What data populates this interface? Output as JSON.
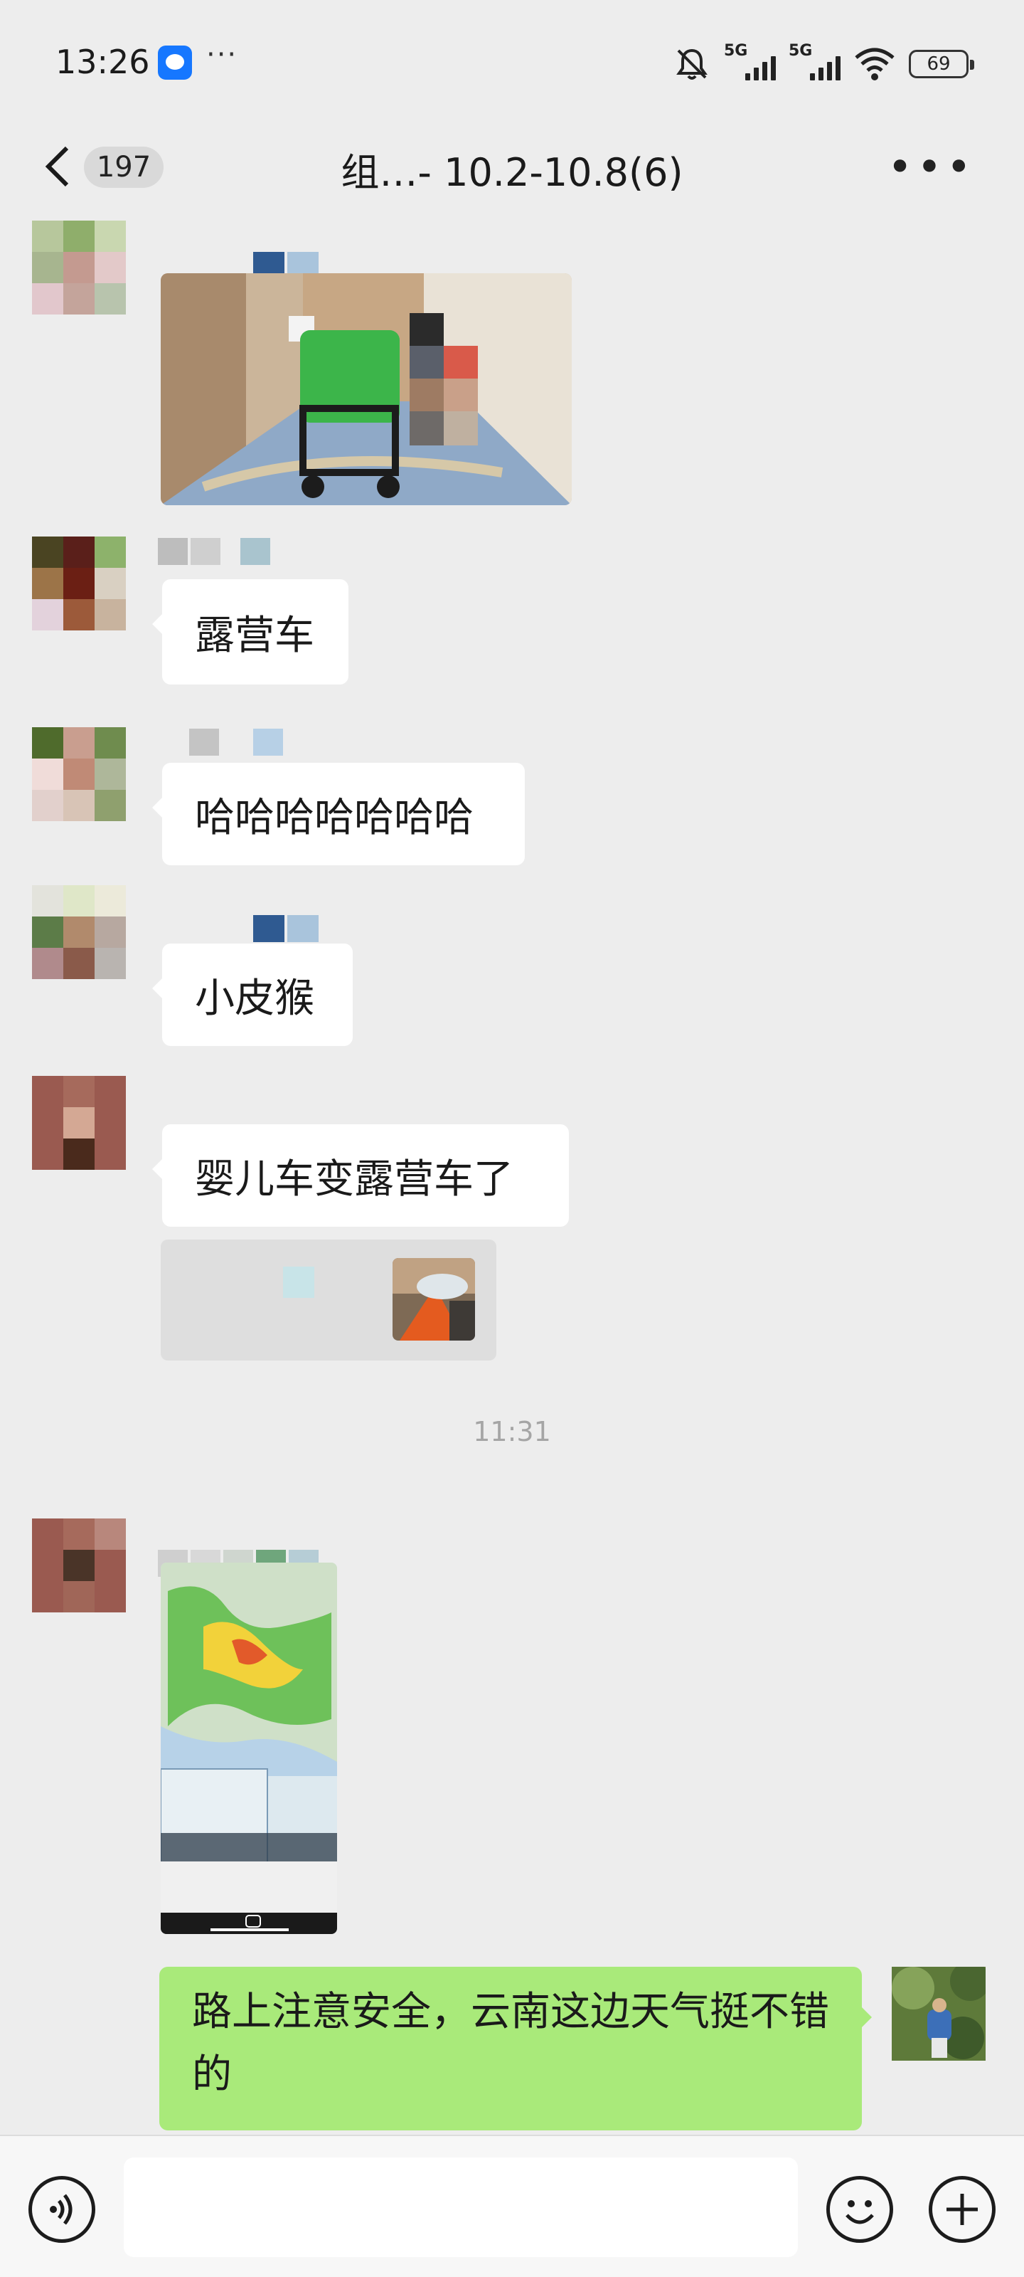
{
  "status_bar": {
    "time": "13:26",
    "more": "···",
    "signal_1_label": "5G",
    "signal_2_label": "5G",
    "battery": "69",
    "icons": [
      "qq-app-icon",
      "mute-icon",
      "signal-icon",
      "signal-icon",
      "wifi-icon",
      "battery-icon"
    ]
  },
  "header": {
    "unread_count": "197",
    "title": "组…- 10.2-10.8(6)",
    "back_icon": "chevron-left-icon",
    "menu_icon": "more-icon"
  },
  "messages": [
    {
      "type": "image",
      "from": "other",
      "content": "stroller-in-hotel-corridor"
    },
    {
      "type": "text",
      "from": "other",
      "text": "露营车"
    },
    {
      "type": "text",
      "from": "other",
      "text": "哈哈哈哈哈哈哈"
    },
    {
      "type": "text",
      "from": "other",
      "text": "小皮猴"
    },
    {
      "type": "text",
      "from": "other",
      "text": "婴儿车变露营车了"
    },
    {
      "type": "quote",
      "from": "other",
      "content": "quoted-image"
    },
    {
      "type": "time",
      "text": "11:31"
    },
    {
      "type": "image",
      "from": "other",
      "content": "weather-radar-map-screenshot"
    },
    {
      "type": "text",
      "from": "me",
      "text": "路上注意安全，云南这边天气挺不错的"
    }
  ],
  "input_bar": {
    "placeholder": "",
    "icons": [
      "voice-icon",
      "emoji-icon",
      "plus-icon"
    ]
  },
  "colors": {
    "background": "#ededed",
    "bubble_other": "#ffffff",
    "bubble_self": "#a9ea7a",
    "timestamp": "#a5a5a5"
  }
}
